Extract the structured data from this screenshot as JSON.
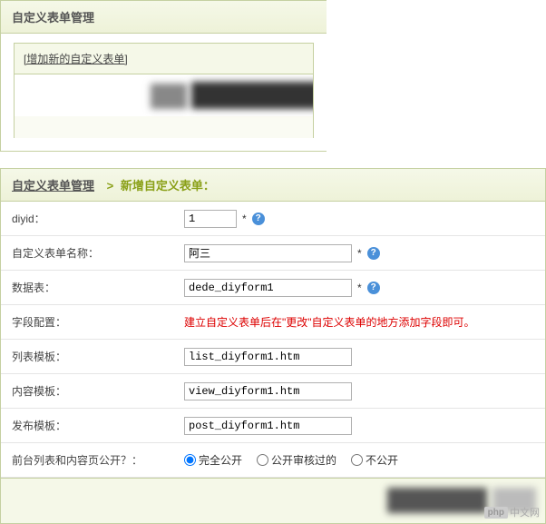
{
  "top": {
    "title": "自定义表单管理",
    "action": "[增加新的自定义表单]"
  },
  "breadcrumb": {
    "root": "自定义表单管理",
    "sep": ">",
    "current": "新增自定义表单："
  },
  "form": {
    "diyid": {
      "label": "diyid：",
      "value": "1",
      "star": "*"
    },
    "name": {
      "label": "自定义表单名称：",
      "value": "阿三",
      "star": "*"
    },
    "table": {
      "label": "数据表：",
      "value": "dede_diyform1",
      "star": "*"
    },
    "fields": {
      "label": "字段配置：",
      "hint": "建立自定义表单后在\"更改\"自定义表单的地方添加字段即可。"
    },
    "list_tpl": {
      "label": "列表模板：",
      "value": "list_diyform1.htm"
    },
    "view_tpl": {
      "label": "内容模板：",
      "value": "view_diyform1.htm"
    },
    "post_tpl": {
      "label": "发布模板：",
      "value": "post_diyform1.htm"
    },
    "public": {
      "label": "前台列表和内容页公开？：",
      "options": [
        {
          "label": "完全公开",
          "checked": true
        },
        {
          "label": "公开审核过的",
          "checked": false
        },
        {
          "label": "不公开",
          "checked": false
        }
      ]
    }
  },
  "watermark": {
    "badge": "php",
    "text": "中文网"
  }
}
